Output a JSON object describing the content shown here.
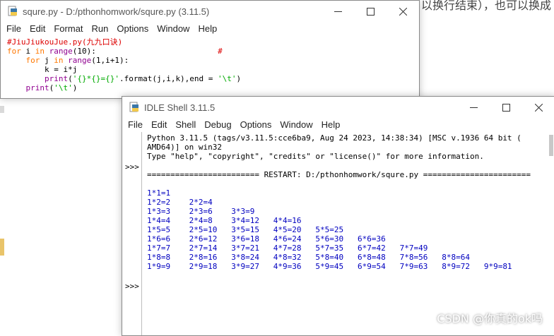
{
  "background": {
    "caption_fragment": "以换行结束），也可以换成"
  },
  "editor": {
    "title": "squre.py - D:/pthonhomwork/squre.py (3.11.5)",
    "menu": [
      "File",
      "Edit",
      "Format",
      "Run",
      "Options",
      "Window",
      "Help"
    ],
    "code": {
      "line1": "#JiuJiukouJue.py(九九口诀)",
      "line2_for": "for",
      "line2_mid": " i ",
      "line2_in": "in",
      "line2_sp": " ",
      "line2_range": "range",
      "line2_args": "(10):",
      "line2_pad": "                          ",
      "line2_hash": "#",
      "line3_indent": "    ",
      "line3_for": "for",
      "line3_mid": " j ",
      "line3_in": "in",
      "line3_sp": " ",
      "line3_range": "range",
      "line3_args": "(1,i+1):",
      "line4": "        k = i*j",
      "line5_indent": "        ",
      "line5_print": "print",
      "line5_open": "(",
      "line5_str1": "'{}*{}={}'",
      "line5_mid": ".format(j,i,k),end = ",
      "line5_str2": "'\\t'",
      "line5_close": ")",
      "line6_indent": "    ",
      "line6_print": "print",
      "line6_open": "(",
      "line6_str": "'\\t'",
      "line6_close": ")"
    }
  },
  "shell": {
    "title": "IDLE Shell 3.11.5",
    "menu": [
      "File",
      "Edit",
      "Shell",
      "Debug",
      "Options",
      "Window",
      "Help"
    ],
    "banner": [
      "Python 3.11.5 (tags/v3.11.5:cce6ba9, Aug 24 2023, 14:38:34) [MSC v.1936 64 bit (",
      "AMD64)] on win32",
      "Type \"help\", \"copyright\", \"credits\" or \"license()\" for more information."
    ],
    "prompt": ">>>",
    "restart_line": "======================== RESTART: D:/pthonhomwork/squre.py =======================",
    "output": [
      "1*1=1",
      "1*2=2    2*2=4",
      "1*3=3    2*3=6    3*3=9",
      "1*4=4    2*4=8    3*4=12   4*4=16",
      "1*5=5    2*5=10   3*5=15   4*5=20   5*5=25",
      "1*6=6    2*6=12   3*6=18   4*6=24   5*6=30   6*6=36",
      "1*7=7    2*7=14   3*7=21   4*7=28   5*7=35   6*7=42   7*7=49",
      "1*8=8    2*8=16   3*8=24   4*8=32   5*8=40   6*8=48   7*8=56   8*8=64",
      "1*9=9    2*9=18   3*9=27   4*9=36   5*9=45   6*9=54   7*9=63   8*9=72   9*9=81"
    ]
  },
  "watermark": "CSDN @你真的ok吗",
  "colors": {
    "keyword": "#ff7700",
    "builtin": "#900090",
    "string": "#00aa00",
    "comment": "#dd0000",
    "output": "#0000c0"
  }
}
